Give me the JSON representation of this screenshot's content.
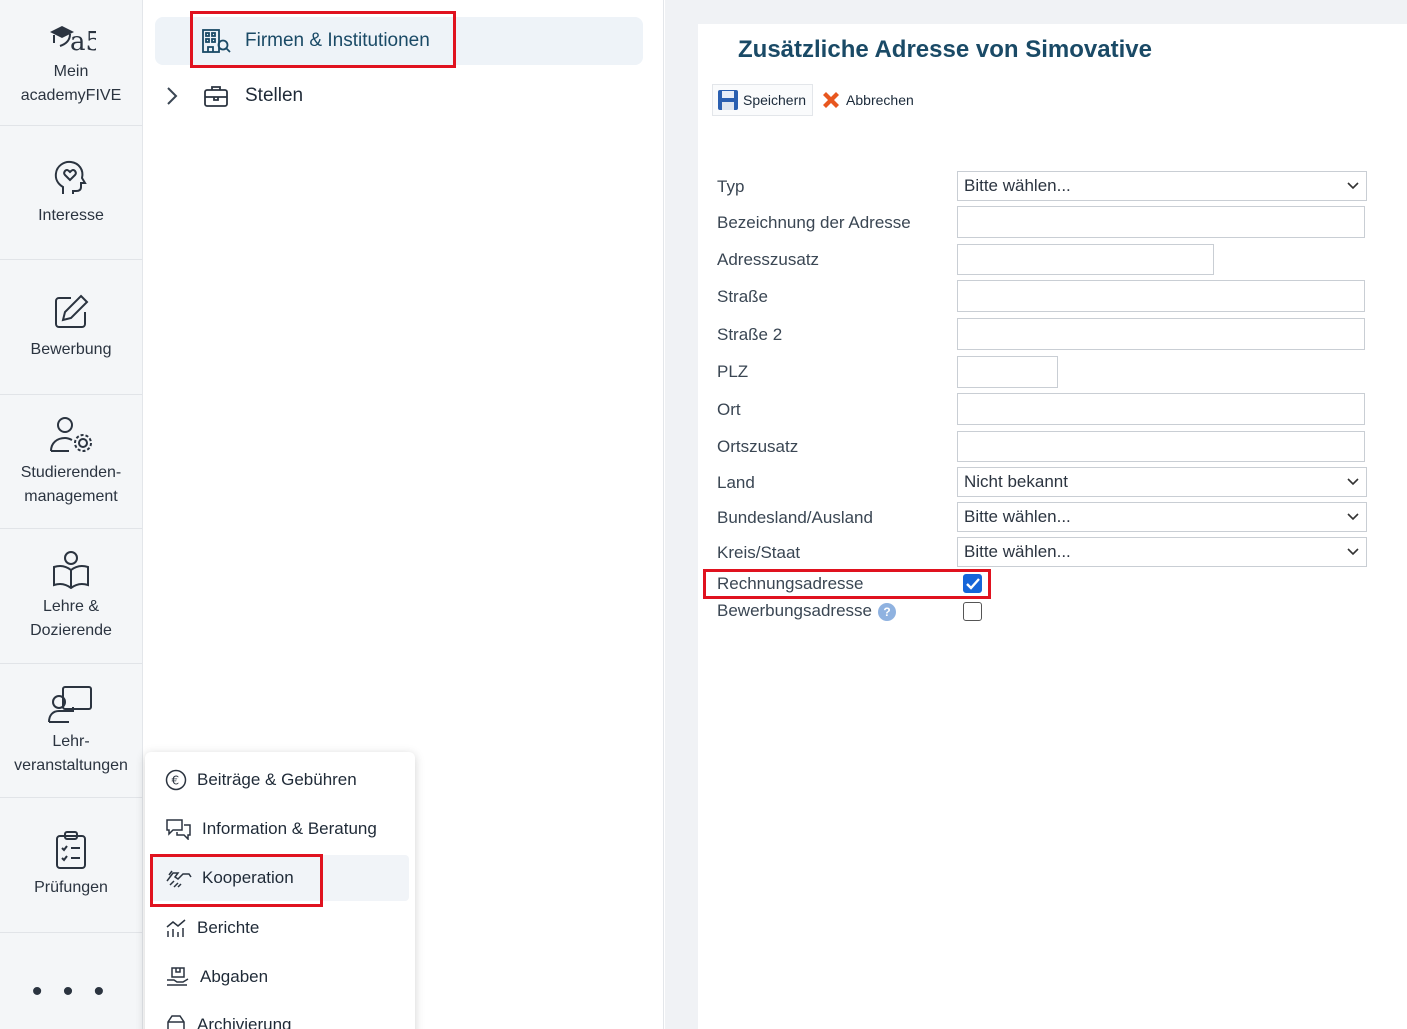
{
  "rail": {
    "items": [
      {
        "label_line1": "Mein",
        "label_line2": "academyFIVE",
        "icon": "academyfive-logo-icon"
      },
      {
        "label_line1": "Interesse",
        "label_line2": "",
        "icon": "head-heart-icon"
      },
      {
        "label_line1": "Bewerbung",
        "label_line2": "",
        "icon": "edit-icon"
      },
      {
        "label_line1": "Studierenden-",
        "label_line2": "management",
        "icon": "user-gear-icon"
      },
      {
        "label_line1": "Lehre &",
        "label_line2": "Dozierende",
        "icon": "reading-icon"
      },
      {
        "label_line1": "Lehr-",
        "label_line2": "veranstaltungen",
        "icon": "presentation-icon"
      },
      {
        "label_line1": "Prüfungen",
        "label_line2": "",
        "icon": "clipboard-icon"
      }
    ],
    "more": "• • •"
  },
  "tree": {
    "items": [
      {
        "label": "Firmen & Institutionen",
        "icon": "building-search-icon",
        "selected": true
      },
      {
        "label": "Stellen",
        "icon": "briefcase-icon",
        "selected": false
      }
    ]
  },
  "popup": {
    "items": [
      {
        "label": "Beiträge & Gebühren",
        "icon": "euro-icon"
      },
      {
        "label": "Information & Beratung",
        "icon": "chat-icon"
      },
      {
        "label": "Kooperation",
        "icon": "handshake-icon",
        "active": true
      },
      {
        "label": "Berichte",
        "icon": "chart-icon"
      },
      {
        "label": "Abgaben",
        "icon": "hand-box-icon"
      },
      {
        "label": "Archivierung",
        "icon": "archive-icon"
      }
    ]
  },
  "form": {
    "title": "Zusätzliche Adresse von Simovative",
    "save_label": "Speichern",
    "cancel_label": "Abbrechen",
    "fields": {
      "typ": {
        "label": "Typ",
        "value": "Bitte wählen..."
      },
      "bezeichnung": {
        "label": "Bezeichnung der Adresse",
        "value": ""
      },
      "adresszusatz": {
        "label": "Adresszusatz",
        "value": ""
      },
      "strasse": {
        "label": "Straße",
        "value": ""
      },
      "strasse2": {
        "label": "Straße 2",
        "value": ""
      },
      "plz": {
        "label": "PLZ",
        "value": ""
      },
      "ort": {
        "label": "Ort",
        "value": ""
      },
      "ortszusatz": {
        "label": "Ortszusatz",
        "value": ""
      },
      "land": {
        "label": "Land",
        "value": "Nicht bekannt"
      },
      "bundesland": {
        "label": "Bundesland/Ausland",
        "value": "Bitte wählen..."
      },
      "kreis": {
        "label": "Kreis/Staat",
        "value": "Bitte wählen..."
      },
      "rechnung": {
        "label": "Rechnungsadresse",
        "checked": true
      },
      "bewerbung": {
        "label": "Bewerbungsadresse",
        "checked": false
      }
    }
  },
  "colors": {
    "accent": "#1a4a66",
    "highlight": "#e0121f",
    "checkbox": "#1565d8"
  }
}
